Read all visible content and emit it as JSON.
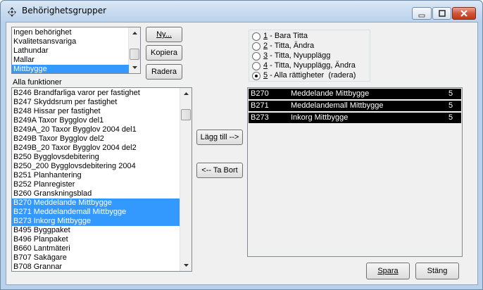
{
  "window": {
    "title": "Behörighetsgrupper"
  },
  "groups": {
    "items": [
      "Ingen behörighet",
      "Kvalitetsansvariga",
      "Lathundar",
      "Mallar",
      "Mittbygge"
    ],
    "selected_index": 4
  },
  "group_buttons": {
    "new": "Ny...",
    "copy": "Kopiera",
    "delete": "Radera"
  },
  "functions": {
    "label": "Alla funktioner",
    "items": [
      "B246 Brandfarliga varor per fastighet",
      "B247 Skyddsrum per fastighet",
      "B248 Hissar per fastighet",
      "B249A Taxor Bygglov del1",
      "B249A_20 Taxor Bygglov 2004 del1",
      "B249B Taxor Bygglov del2",
      "B249B_20 Taxor Bygglov 2004 del2",
      "B250 Bygglovsdebitering",
      "B250_200 Bygglovsdebitering 2004",
      "B251 Planhantering",
      "B252 Planregister",
      "B260 Granskningsblad",
      "B270 Meddelande Mittbygge",
      "B271 Meddelandemall Mittbygge",
      "B273 Inkorg Mittbygge",
      "B495 Byggpaket",
      "B496 Planpaket",
      "B660 Lantmäteri",
      "B707 Sakägare",
      "B708 Grannar"
    ],
    "selected_indices": [
      12,
      13,
      14
    ]
  },
  "transfer_buttons": {
    "add": "Lägg till -->",
    "remove": "<-- Ta Bort"
  },
  "rights": {
    "options": [
      {
        "num": "1",
        "text": " - Bara Titta"
      },
      {
        "num": "2",
        "text": " - Titta, Ändra"
      },
      {
        "num": "3",
        "text": " - Titta, Nyupplägg"
      },
      {
        "num": "4",
        "text": " - Titta, Nyupplägg, Ändra"
      },
      {
        "num": "5",
        "text": " - Alla rättigheter  (radera)"
      }
    ],
    "selected_index": 4
  },
  "assigned": {
    "rows": [
      {
        "code": "B270",
        "name": "Meddelande Mittbygge",
        "level": "5"
      },
      {
        "code": "B271",
        "name": "Meddelandemall Mittbygge",
        "level": "5"
      },
      {
        "code": "B273",
        "name": "Inkorg Mittbygge",
        "level": "5"
      }
    ]
  },
  "footer_buttons": {
    "save": "Spara",
    "close": "Stäng"
  }
}
